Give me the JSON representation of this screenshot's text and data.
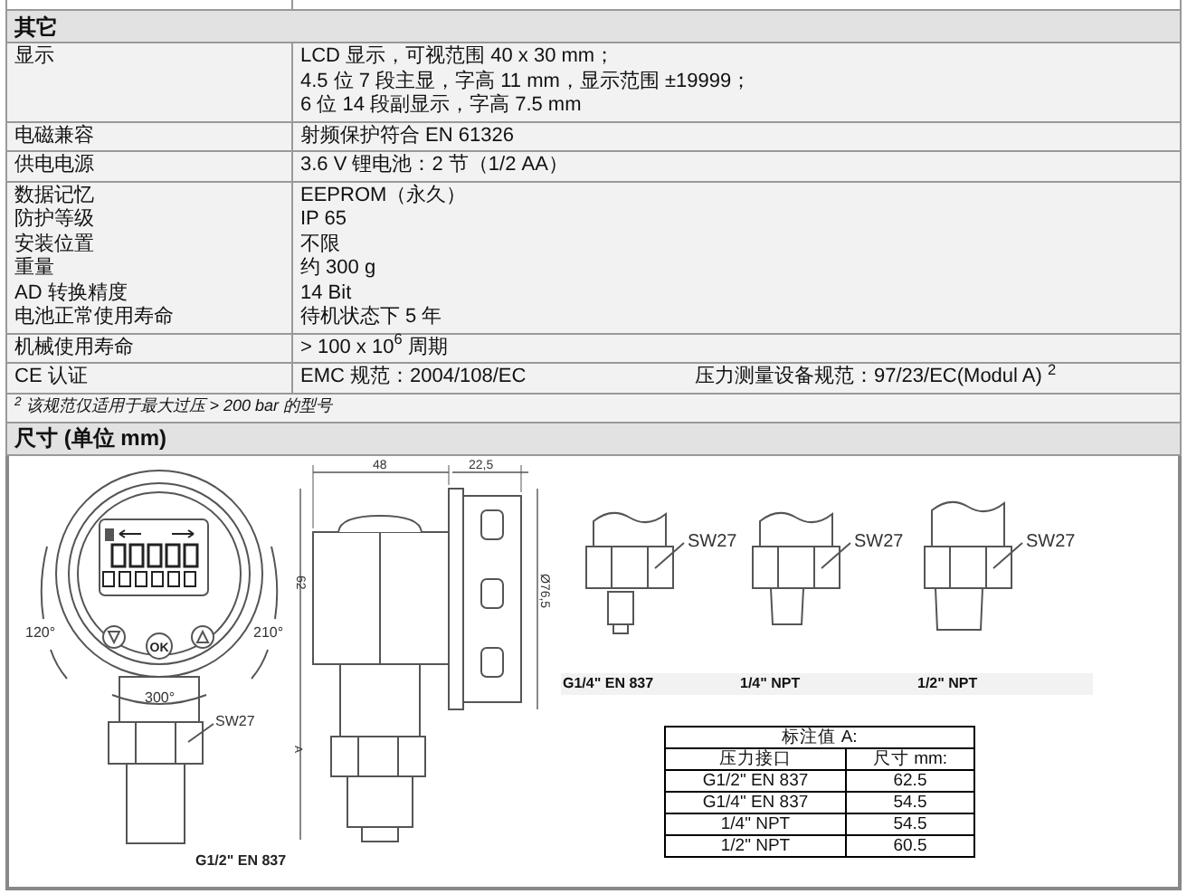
{
  "other_section": {
    "title": "其它",
    "groups": [
      [
        {
          "label": "显示",
          "lines": [
            "LCD 显示，可视范围 40 x 30 mm；",
            "4.5 位 7 段主显，字高 11 mm，显示范围 ±19999；",
            "6 位 14 段副显示，字高 7.5 mm"
          ]
        }
      ],
      [
        {
          "label": "电磁兼容",
          "lines": [
            "射频保护符合 EN 61326"
          ]
        }
      ],
      [
        {
          "label": "供电电源",
          "lines": [
            "3.6 V 锂电池：2 节（1/2 AA）"
          ]
        }
      ],
      [
        {
          "label": "数据记忆",
          "lines": [
            "EEPROM（永久）"
          ]
        },
        {
          "label": "防护等级",
          "lines": [
            "IP 65"
          ]
        },
        {
          "label": "安装位置",
          "lines": [
            "不限"
          ]
        },
        {
          "label": "重量",
          "lines": [
            "约 300 g"
          ]
        },
        {
          "label": "AD 转换精度",
          "lines": [
            " 14 Bit"
          ]
        },
        {
          "label": "电池正常使用寿命",
          "lines": [
            "待机状态下 5 年"
          ]
        }
      ],
      [
        {
          "label": "机械使用寿命",
          "lines": [
            "> 100 x 10$^{6}$ 周期"
          ]
        }
      ],
      [
        {
          "label": "CE 认证",
          "lines": [
            "EMC 规范：2004/108/EC"
          ],
          "second_value": "压力测量设备规范：97/23/EC(Modul A) $^{2}$"
        }
      ]
    ],
    "footnote": "$^{2}$ 该规范仅适用于最大过压 > 200 bar 的型号"
  },
  "dimensions_section": {
    "title": "尺寸 (单位 mm)",
    "front_view": {
      "angle_left": "120°",
      "angle_right": "210°",
      "angle_bottom": "300°",
      "wrench_label": "SW27",
      "ok_label": "OK",
      "caption": "G1/2\" EN 837"
    },
    "side_view": {
      "width_dim": "48",
      "depth_dim": "22,5",
      "height_dim": "62",
      "diameter_dim": "Ø76,5",
      "a_dim": "A"
    },
    "fittings": [
      {
        "kind": "nipple",
        "label": "SW27",
        "caption": "G1/4\" EN 837"
      },
      {
        "kind": "npt_small",
        "label": "SW27",
        "caption": "1/4\" NPT"
      },
      {
        "kind": "npt_large",
        "label": "SW27",
        "caption": "1/2\" NPT"
      }
    ],
    "table": {
      "title": "标注值 A:",
      "columns": [
        "压力接口",
        "尺寸 mm:"
      ],
      "rows": [
        [
          "G1/2\" EN 837",
          "62.5"
        ],
        [
          "G1/4\" EN 837",
          "54.5"
        ],
        [
          "1/4\" NPT",
          "54.5"
        ],
        [
          "1/2\" NPT",
          "60.5"
        ]
      ]
    }
  }
}
